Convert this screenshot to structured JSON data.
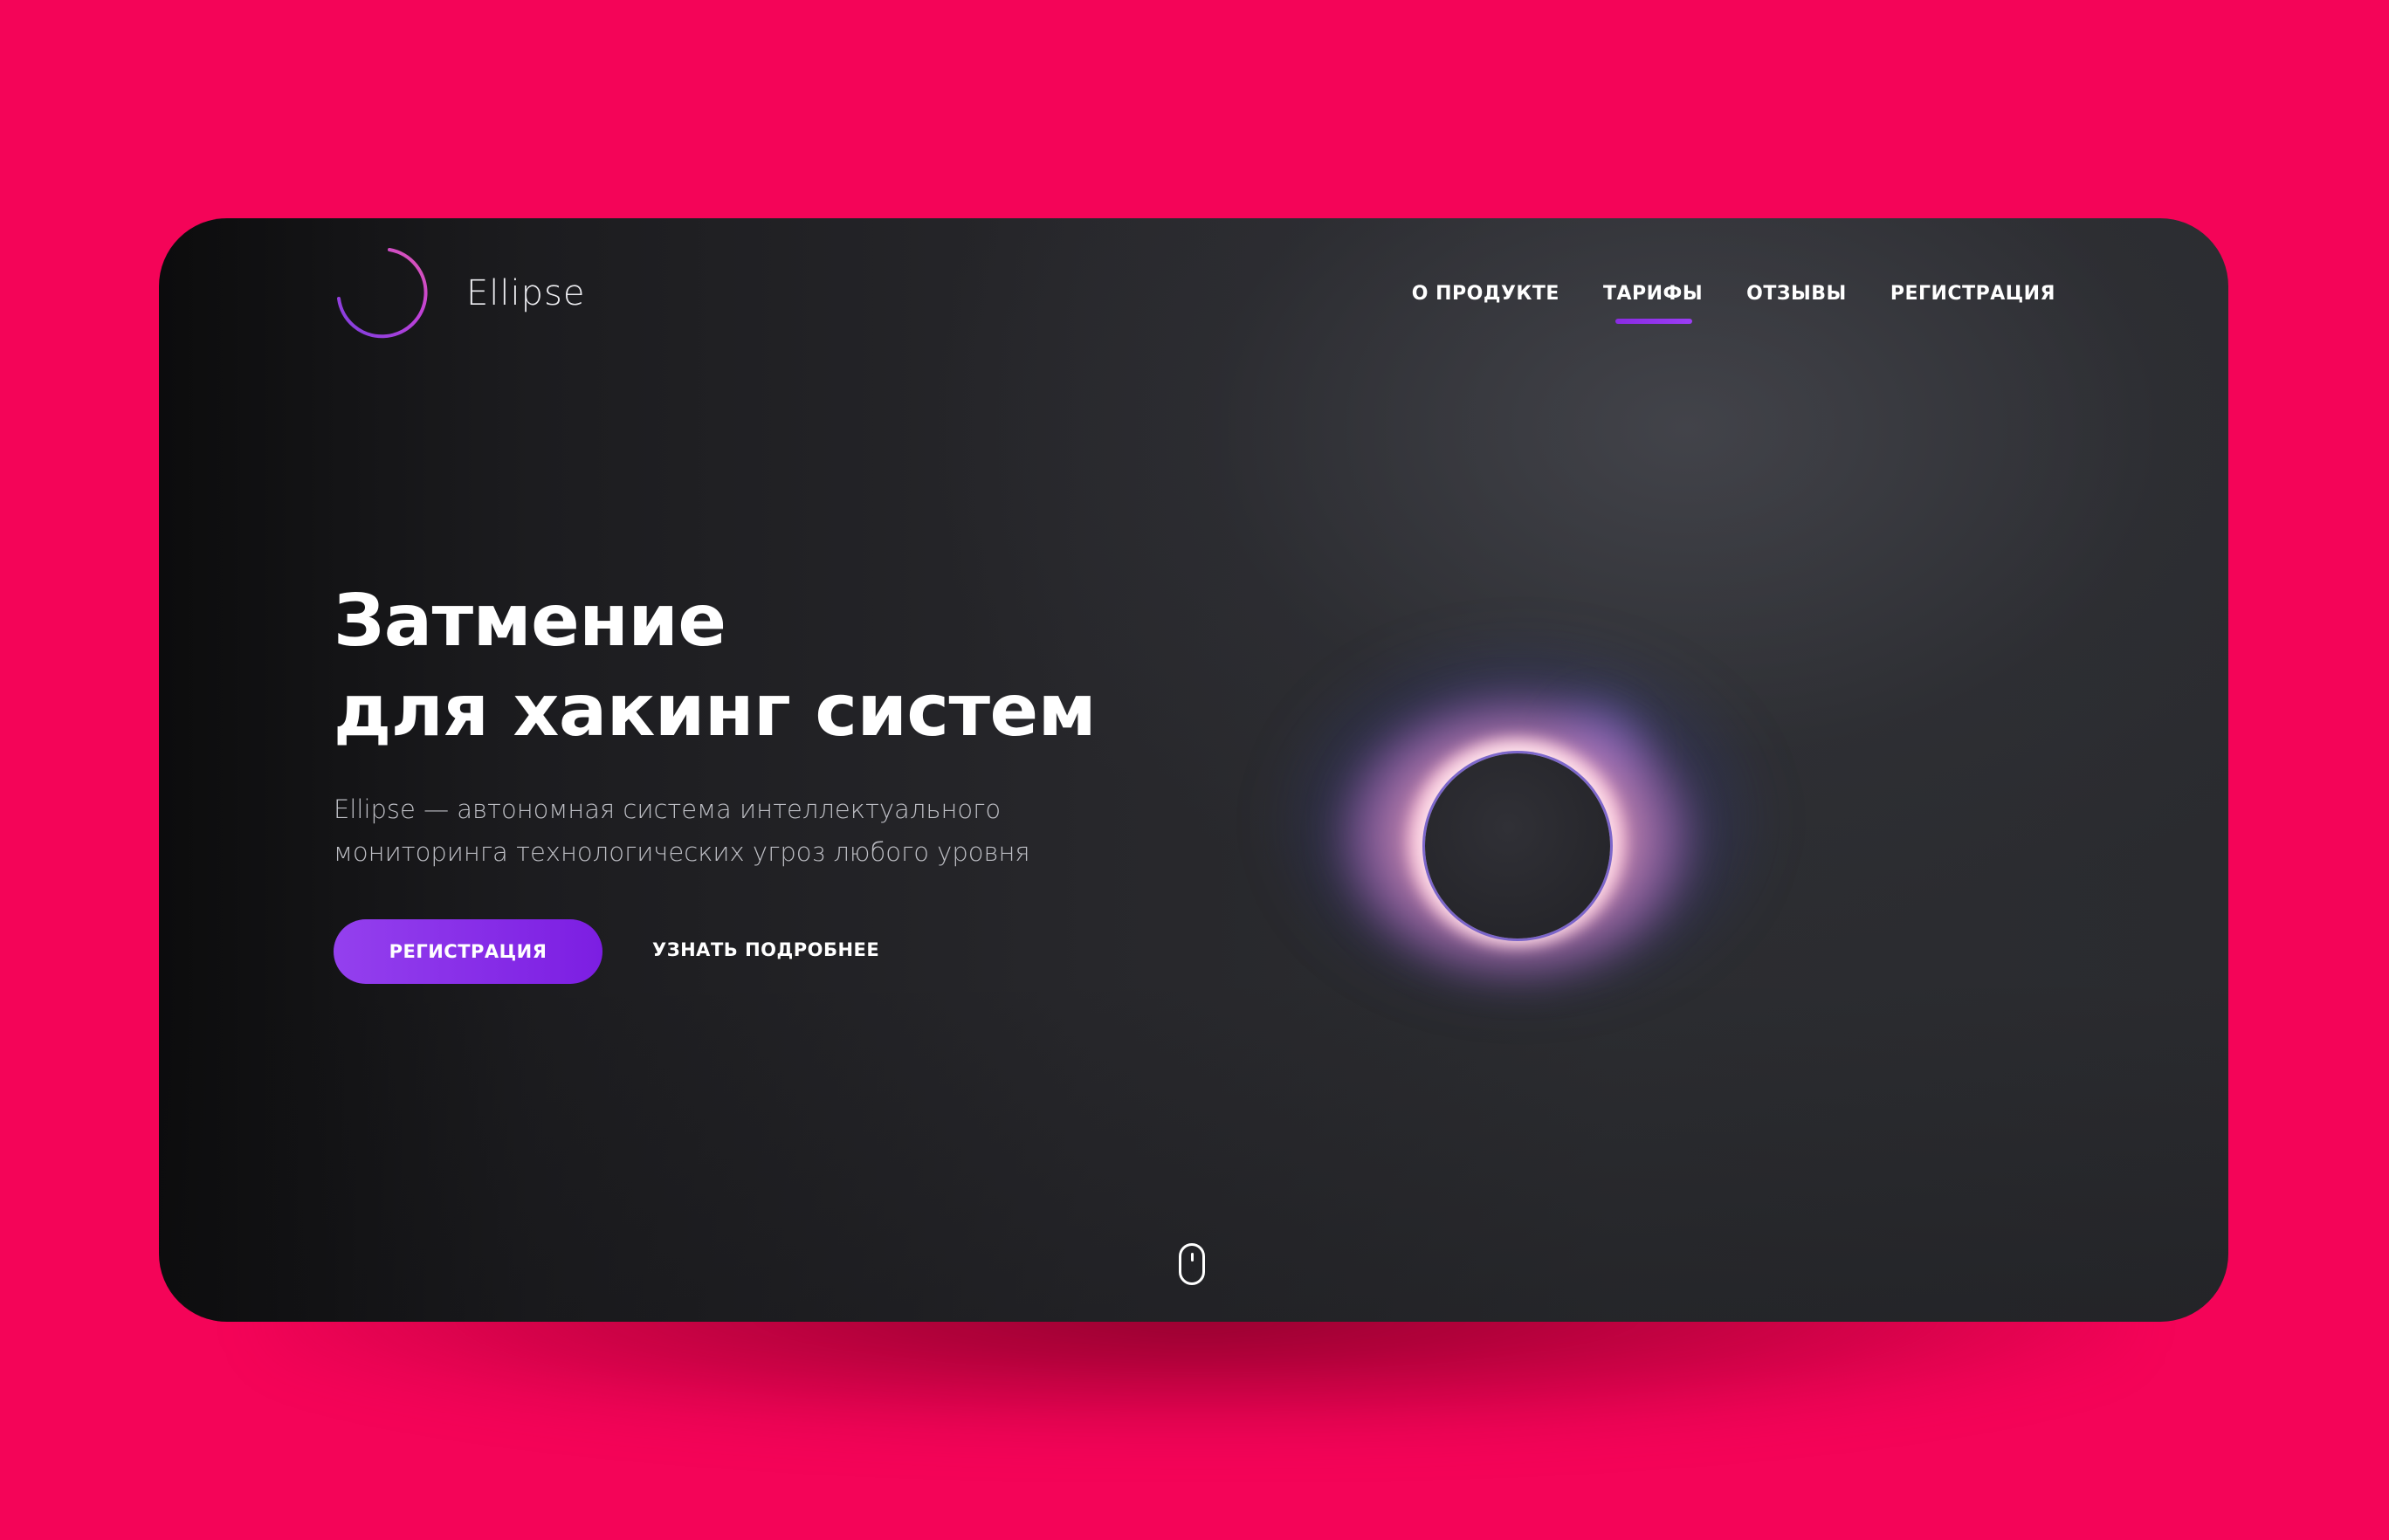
{
  "brand": {
    "name": "Ellipse"
  },
  "nav": {
    "items": [
      {
        "label": "О ПРОДУКТЕ",
        "active": false
      },
      {
        "label": "ТАРИФЫ",
        "active": true
      },
      {
        "label": "ОТЗЫВЫ",
        "active": false
      },
      {
        "label": "РЕГИСТРАЦИЯ",
        "active": false
      }
    ]
  },
  "hero": {
    "title_line1": "Затмение",
    "title_line2": "для хакинг систем",
    "subtitle_line1": "Ellipse — автономная система интеллектуального",
    "subtitle_line2": "мониторинга технологических угроз любого уровня",
    "primary_button": "РЕГИСТРАЦИЯ",
    "secondary_link": "УЗНАТЬ ПОДРОБНЕЕ"
  },
  "icons": {
    "logo": "ellipse-arc-logo-icon",
    "eclipse": "solar-eclipse-illustration",
    "scroll": "mouse-scroll-icon"
  },
  "colors": {
    "background": "#f40458",
    "card": "#27272b",
    "accent": "#8a2be2",
    "accent_gradient_start": "#9440ee",
    "accent_gradient_end": "#7c1ee2"
  }
}
